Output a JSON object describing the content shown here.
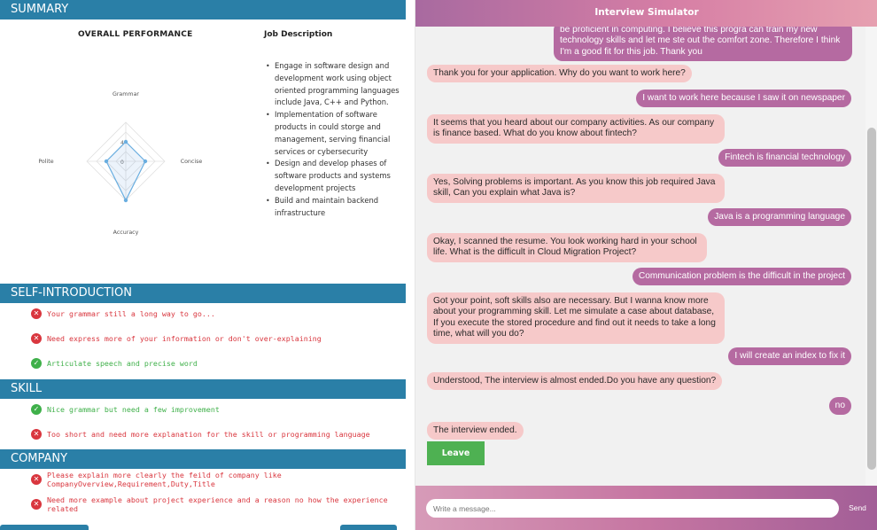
{
  "summary": {
    "header": "SUMMARY",
    "performance_title": "OVERALL PERFORMANCE",
    "job_title": "Job Description",
    "job_items": [
      "Engage in software design and development work using object oriented programming languages include Java, C++ and Python.",
      "Implementation of software products in could storge and management, serving financial services or cybersecurity",
      "Design and develop phases of software products and systems development projects",
      "Build and maintain backend infrastructure"
    ],
    "radar": {
      "axes": [
        "Grammar",
        "Concise",
        "Accuracy",
        "Polite"
      ],
      "tick_labels": [
        "4",
        "0"
      ],
      "values": [
        2,
        2,
        4,
        2
      ]
    }
  },
  "self_intro": {
    "header": "SELF-INTRODUCTION",
    "items": [
      {
        "status": "bad",
        "text": "Your grammar still a long way to go..."
      },
      {
        "status": "bad",
        "text": "Need express more of your information or don't over-explaining"
      },
      {
        "status": "good",
        "text": "Articulate speech and precise word"
      }
    ]
  },
  "skill": {
    "header": "SKILL",
    "items": [
      {
        "status": "good",
        "text": "Nice grammar but need a few improvement"
      },
      {
        "status": "bad",
        "text": "Too short and need more explanation for the skill or programming language"
      }
    ]
  },
  "company": {
    "header": "COMPANY",
    "items": [
      {
        "status": "bad",
        "text": "Please explain more clearly the feild of company like CompanyOverview,Requirement,Duty,Title"
      },
      {
        "status": "bad",
        "text": "Need more example about project experience and a reason no how the experience related"
      }
    ]
  },
  "icons": {
    "bad": "x-circle-icon",
    "good": "check-circle-icon"
  },
  "colors": {
    "bad": "#d9363e",
    "good": "#3fb04a",
    "section": "#2a7fa7",
    "bot_bubble": "#f6c9c9",
    "user_bubble": "#b56aa1",
    "leave": "#4eb152"
  },
  "chat": {
    "title": "Interview Simulator",
    "messages": [
      {
        "from": "user",
        "text": "be proficient in computing. I believe this progra can train my new technology skills and let me ste out the comfort zone. Therefore I think I'm a good fit for this job. Thank you"
      },
      {
        "from": "bot",
        "text": "Thank you for your application. Why do you want to work here?"
      },
      {
        "from": "user",
        "text": "I want to work here because I saw it on newspaper"
      },
      {
        "from": "bot",
        "text": "It seems that you heard about our company activities. As our company is finance based. What do you know about fintech?"
      },
      {
        "from": "user",
        "text": "Fintech is financial technology"
      },
      {
        "from": "bot",
        "text": "Yes, Solving problems is important. As you know this job required Java skill, Can you explain what Java is?"
      },
      {
        "from": "user",
        "text": "Java is a programming language"
      },
      {
        "from": "bot",
        "text": "Okay, I scanned the resume. You look working hard in your school life. What is the difficult in Cloud Migration Project?"
      },
      {
        "from": "user",
        "text": "Communication problem is the difficult in the project"
      },
      {
        "from": "bot",
        "text": "Got your point, soft skills also are necessary. But I wanna know more about your programming skill. Let me simulate a case about database, If you execute the stored procedure and find out it needs to take a long time, what will you do?"
      },
      {
        "from": "user",
        "text": "I will create an index to fix it"
      },
      {
        "from": "bot",
        "text": "Understood, The interview is almost ended.Do you have any question?"
      },
      {
        "from": "user",
        "text": "no"
      },
      {
        "from": "bot",
        "text": "The interview ended."
      }
    ],
    "leave_label": "Leave",
    "input_placeholder": "Write a message...",
    "send_label": "Send"
  }
}
